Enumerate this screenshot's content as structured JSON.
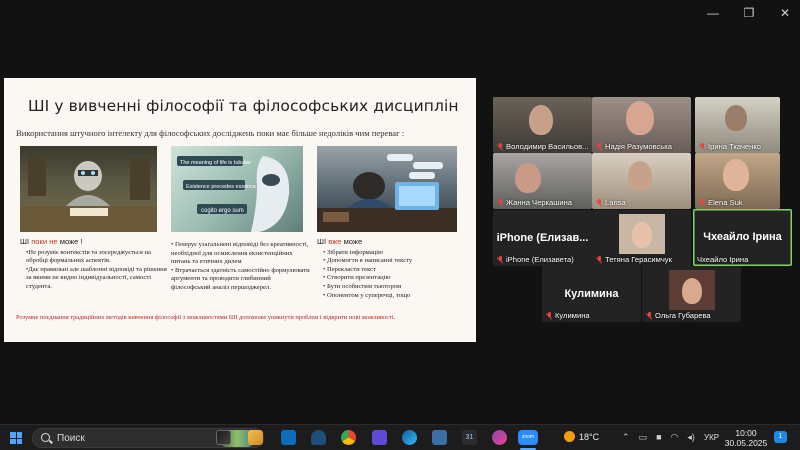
{
  "window": {
    "minimize": "—",
    "restore": "❐",
    "close": "✕"
  },
  "slide": {
    "title": "ШІ у вивченні філософії та філософських дисциплін",
    "subtitle": "Використання штучного інтелекту для філософських досліджень поки  має  більше недоліків чим переваг :",
    "image_texts": [
      "The meaning of life is tubular",
      "Existence precedes essence",
      "cogito ergo sum"
    ],
    "col1": {
      "head_pre": "ШІ ",
      "head_red1": "поки ",
      "head_red2": "не ",
      "head_post": "може !",
      "items": [
        "•Не розуміє контекстів та зосереджується на обробці формальних аспектів.",
        "•Дає правильні але шаблонні відповіді та рішення за якими не видно індивідуальності, самості студента."
      ]
    },
    "col2": {
      "items": [
        "• Генерує узагальнені відповіді  без креативності, необхідної для осмислення екзистенційних питань та етичних дилем",
        "• Втрачається  здатність самостійно формулювати аргументи та проводити глибинний філософський аналіз першоджерел."
      ]
    },
    "col3": {
      "head_pre": "ШІ  ",
      "head_red": "вже ",
      "head_post": "може",
      "items": [
        "• Зібрати інформацію",
        "• Допомогти в написанні тексту",
        "• Перекласти текст",
        "• Створити презентацію",
        "• Бути особистим тьютором",
        "• Опонентом у суперечці, тощо"
      ]
    },
    "footer": "Розумне поєднання традиційних методів вивчення філософії  з можливостями ШІ допоможе уникнути  проблем і відкрити нові можливості."
  },
  "participants": [
    {
      "name": "Володимир Васильов..."
    },
    {
      "name": "Надія Разумовська"
    },
    {
      "name": "Ірина Ткаченко"
    },
    {
      "name": "Жанна Черкашина"
    },
    {
      "name": "Larisa"
    },
    {
      "name": "Elena Suk"
    },
    {
      "name": "iPhone (Елизавета)",
      "big": "iPhone  (Елизав..."
    },
    {
      "name": "Тетяна Герасимчук"
    },
    {
      "name": "Чхеайло Ірина",
      "big": "Чхеайло Ірина"
    },
    {
      "name": "Кулимина",
      "big": "Кулимина"
    },
    {
      "name": "Ольга Губарева"
    }
  ],
  "taskbar": {
    "search_label": "Поиск",
    "temperature": "18°C",
    "language": "УКР",
    "time": "10:00",
    "date": "30.05.2025",
    "notifications": "1",
    "app31": "31",
    "zoom_label": "zoom"
  }
}
